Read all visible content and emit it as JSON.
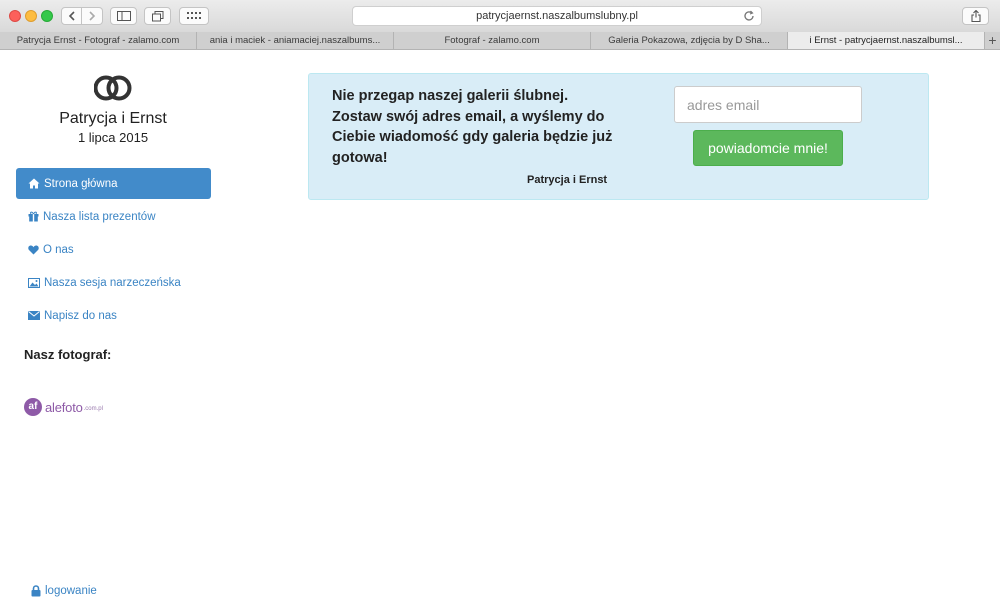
{
  "browser": {
    "url": "patrycjaernst.naszalbumslubny.pl",
    "tabs": [
      {
        "label": "Patrycja Ernst - Fotograf - zalamo.com",
        "active": false
      },
      {
        "label": "ania i maciek - aniamaciej.naszalbums...",
        "active": false
      },
      {
        "label": "Fotograf - zalamo.com",
        "active": false
      },
      {
        "label": "Galeria Pokazowa, zdjęcia by D Sha...",
        "active": false
      },
      {
        "label": "i Ernst - patrycjaernst.naszalbumsl...",
        "active": true
      }
    ],
    "new_tab_label": "+"
  },
  "sidebar": {
    "couple_name": "Patrycja i Ernst",
    "date": "1 lipca 2015",
    "nav": [
      {
        "label": "Strona główna",
        "icon": "home-icon",
        "active": true
      },
      {
        "label": "Nasza lista prezentów",
        "icon": "gift-icon",
        "active": false
      },
      {
        "label": "O nas",
        "icon": "heart-icon",
        "active": false
      },
      {
        "label": "Nasza sesja narzeczeńska",
        "icon": "picture-icon",
        "active": false
      },
      {
        "label": "Napisz do nas",
        "icon": "envelope-icon",
        "active": false
      }
    ],
    "photographer_label": "Nasz fotograf:",
    "photographer_logo": {
      "mark": "af",
      "name": "alefoto",
      "domain": ".com.pl"
    },
    "login_label": "logowanie"
  },
  "notice": {
    "lines": [
      "Nie przegap naszej galerii ślubnej.",
      "Zostaw swój adres email, a wyślemy do",
      "Ciebie wiadomość gdy galeria będzie już",
      "gotowa!"
    ],
    "signature": "Patrycja i Ernst",
    "email_placeholder": "adres email",
    "email_value": "",
    "button_label": "powiadomcie mnie!"
  },
  "colors": {
    "accent": "#428bca",
    "link": "#3a84c4",
    "notice_bg": "#d9edf7",
    "button_green": "#5cb85c"
  }
}
